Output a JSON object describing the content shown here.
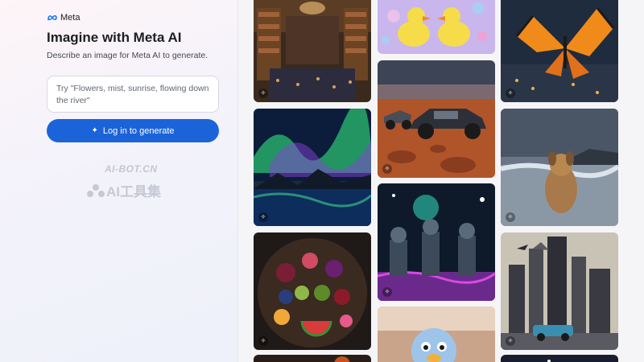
{
  "brand": {
    "name": "Meta",
    "logo_icon": "meta-infinity-icon"
  },
  "hero": {
    "title": "Imagine with Meta AI",
    "subtitle": "Describe an image for Meta AI to generate."
  },
  "prompt": {
    "placeholder": "Try \"Flowers, mist, sunrise, flowing down the river\"",
    "value": ""
  },
  "login_button": {
    "label": "Log in to generate",
    "icon": "sparkle-icon"
  },
  "watermark": {
    "line1": "AI-BOT.CN",
    "line2": "AI工具集"
  },
  "colors": {
    "accent": "#1b63d8",
    "panel_bg": "#f6f3fa",
    "text": "#1c1e21"
  },
  "gallery": {
    "tiles": [
      {
        "subject": "library interior",
        "icon": "image-generate-icon"
      },
      {
        "subject": "rubber ducks with bubbles",
        "icon": "image-generate-icon"
      },
      {
        "subject": "butterfly over city street",
        "icon": "image-generate-icon"
      },
      {
        "subject": "aurora over lake",
        "icon": "image-generate-icon"
      },
      {
        "subject": "race car in desert",
        "icon": "image-generate-icon"
      },
      {
        "subject": "dog in ocean waves",
        "icon": "image-generate-icon"
      },
      {
        "subject": "bowl of fruit",
        "icon": "image-generate-icon"
      },
      {
        "subject": "space explorers on alien planet",
        "icon": "image-generate-icon"
      },
      {
        "subject": "futuristic city with car",
        "icon": "image-generate-icon"
      },
      {
        "subject": "fluffy bird cartoon",
        "icon": "image-generate-icon"
      },
      {
        "subject": "food close-up",
        "icon": "image-generate-icon"
      },
      {
        "subject": "night sky",
        "icon": "image-generate-icon"
      }
    ]
  }
}
